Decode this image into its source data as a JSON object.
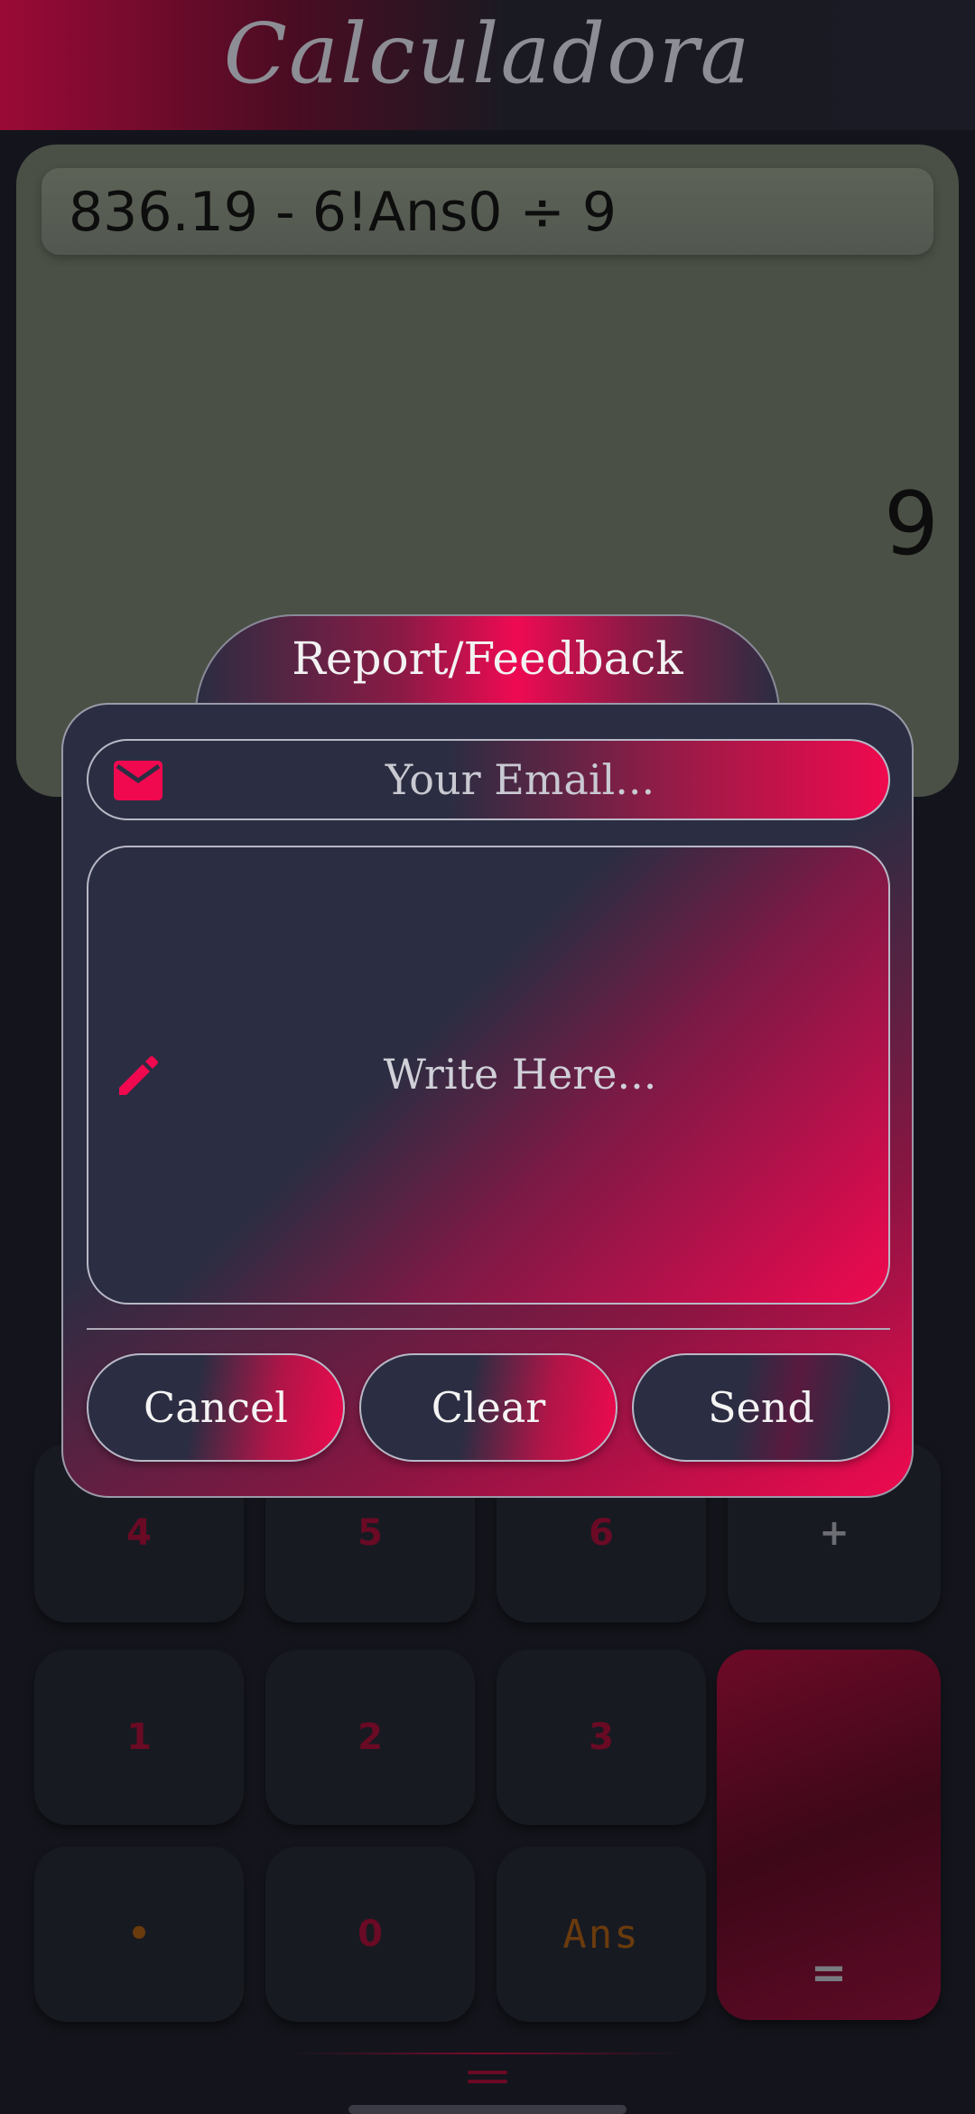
{
  "header": {
    "title": "Calculadora"
  },
  "display": {
    "expression": "836.19 - 6!Ans0 ÷ 9",
    "result": "9"
  },
  "keypad": {
    "row_4": [
      "4",
      "5",
      "6",
      "+"
    ],
    "row_1": [
      "1",
      "2",
      "3"
    ],
    "row_0": [
      "•",
      "0",
      "Ans"
    ],
    "equals": "="
  },
  "modal": {
    "title": "Report/Feedback",
    "email_placeholder": "Your Email...",
    "message_placeholder": "Write Here...",
    "buttons": {
      "cancel": "Cancel",
      "clear": "Clear",
      "send": "Send"
    },
    "icons": {
      "email": "mail-icon",
      "message": "pencil-icon"
    },
    "accent_color": "#F0094F",
    "panel_color": "#2B2D42"
  },
  "footer": {
    "menu_icon": "menu-icon"
  }
}
